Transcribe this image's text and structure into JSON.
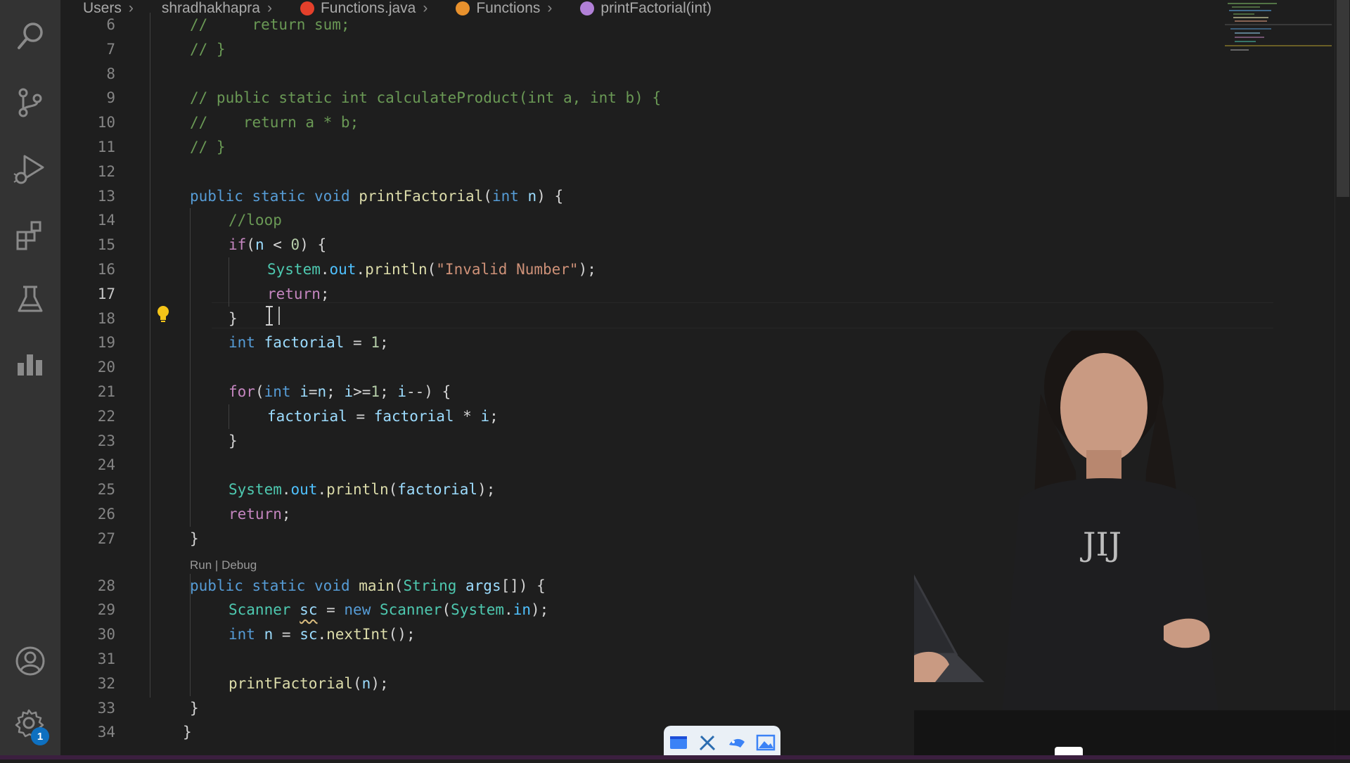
{
  "breadcrumb": [
    {
      "label": "Users",
      "icon": "",
      "icon_color": ""
    },
    {
      "label": "shradhakhapra",
      "icon": "",
      "icon_color": ""
    },
    {
      "label": "Functions.java",
      "icon": "java-file-icon",
      "icon_color": "#e5402b"
    },
    {
      "label": "Functions",
      "icon": "class-symbol-icon",
      "icon_color": "#e8912d"
    },
    {
      "label": "printFactorial(int)",
      "icon": "method-symbol-icon",
      "icon_color": "#b180d7"
    }
  ],
  "activity_bar": {
    "items": [
      {
        "name": "search-icon"
      },
      {
        "name": "source-control-icon"
      },
      {
        "name": "run-debug-icon"
      },
      {
        "name": "extensions-icon"
      },
      {
        "name": "testing-icon"
      },
      {
        "name": "charts-icon"
      }
    ],
    "bottom": [
      {
        "name": "accounts-icon"
      },
      {
        "name": "manage-gear-icon",
        "badge": "1"
      }
    ]
  },
  "editor": {
    "active_line": 17,
    "codelens": {
      "before_line": 28,
      "run": "Run",
      "separator": " | ",
      "debug": "Debug"
    },
    "lines": [
      {
        "n": 6,
        "indent": 1,
        "tokens": [
          [
            "cmt",
            "//     return sum;"
          ]
        ]
      },
      {
        "n": 7,
        "indent": 1,
        "tokens": [
          [
            "cmt",
            "// }"
          ]
        ]
      },
      {
        "n": 8,
        "indent": 0,
        "tokens": []
      },
      {
        "n": 9,
        "indent": 1,
        "tokens": [
          [
            "cmt",
            "// public static int calculateProduct(int a, int b) {"
          ]
        ]
      },
      {
        "n": 10,
        "indent": 1,
        "tokens": [
          [
            "cmt",
            "//    return a * b;"
          ]
        ]
      },
      {
        "n": 11,
        "indent": 1,
        "tokens": [
          [
            "cmt",
            "// }"
          ]
        ]
      },
      {
        "n": 12,
        "indent": 0,
        "tokens": []
      },
      {
        "n": 13,
        "indent": 1,
        "tokens": [
          [
            "kw",
            "public"
          ],
          [
            "p",
            " "
          ],
          [
            "kw",
            "static"
          ],
          [
            "p",
            " "
          ],
          [
            "kw",
            "void"
          ],
          [
            "p",
            " "
          ],
          [
            "fn",
            "printFactorial"
          ],
          [
            "p",
            "("
          ],
          [
            "kw",
            "int"
          ],
          [
            "p",
            " "
          ],
          [
            "var",
            "n"
          ],
          [
            "p",
            ") {"
          ]
        ]
      },
      {
        "n": 14,
        "indent": 2,
        "tokens": [
          [
            "cmt",
            "//loop"
          ]
        ]
      },
      {
        "n": 15,
        "indent": 2,
        "tokens": [
          [
            "ctl",
            "if"
          ],
          [
            "p",
            "("
          ],
          [
            "var",
            "n"
          ],
          [
            "p",
            " < "
          ],
          [
            "num",
            "0"
          ],
          [
            "p",
            ") {"
          ]
        ]
      },
      {
        "n": 16,
        "indent": 3,
        "tokens": [
          [
            "type",
            "System"
          ],
          [
            "p",
            "."
          ],
          [
            "var2",
            "out"
          ],
          [
            "p",
            "."
          ],
          [
            "fn",
            "println"
          ],
          [
            "p",
            "("
          ],
          [
            "str",
            "\"Invalid Number\""
          ],
          [
            "p",
            ");"
          ]
        ]
      },
      {
        "n": 17,
        "indent": 3,
        "tokens": [
          [
            "ctl",
            "return"
          ],
          [
            "p",
            ";"
          ]
        ]
      },
      {
        "n": 18,
        "indent": 2,
        "tokens": [
          [
            "p",
            "}"
          ]
        ]
      },
      {
        "n": 19,
        "indent": 2,
        "tokens": [
          [
            "kw",
            "int"
          ],
          [
            "p",
            " "
          ],
          [
            "var",
            "factorial"
          ],
          [
            "p",
            " = "
          ],
          [
            "num",
            "1"
          ],
          [
            "p",
            ";"
          ]
        ]
      },
      {
        "n": 20,
        "indent": 0,
        "tokens": []
      },
      {
        "n": 21,
        "indent": 2,
        "tokens": [
          [
            "ctl",
            "for"
          ],
          [
            "p",
            "("
          ],
          [
            "kw",
            "int"
          ],
          [
            "p",
            " "
          ],
          [
            "var",
            "i"
          ],
          [
            "p",
            "="
          ],
          [
            "var",
            "n"
          ],
          [
            "p",
            "; "
          ],
          [
            "var",
            "i"
          ],
          [
            "p",
            ">="
          ],
          [
            "num",
            "1"
          ],
          [
            "p",
            "; "
          ],
          [
            "var",
            "i"
          ],
          [
            "p",
            "--) {"
          ]
        ]
      },
      {
        "n": 22,
        "indent": 3,
        "tokens": [
          [
            "var",
            "factorial"
          ],
          [
            "p",
            " = "
          ],
          [
            "var",
            "factorial"
          ],
          [
            "p",
            " * "
          ],
          [
            "var",
            "i"
          ],
          [
            "p",
            ";"
          ]
        ]
      },
      {
        "n": 23,
        "indent": 2,
        "tokens": [
          [
            "p",
            "}"
          ]
        ]
      },
      {
        "n": 24,
        "indent": 0,
        "tokens": []
      },
      {
        "n": 25,
        "indent": 2,
        "tokens": [
          [
            "type",
            "System"
          ],
          [
            "p",
            "."
          ],
          [
            "var2",
            "out"
          ],
          [
            "p",
            "."
          ],
          [
            "fn",
            "println"
          ],
          [
            "p",
            "("
          ],
          [
            "var",
            "factorial"
          ],
          [
            "p",
            ");"
          ]
        ]
      },
      {
        "n": 26,
        "indent": 2,
        "tokens": [
          [
            "ctl",
            "return"
          ],
          [
            "p",
            ";"
          ]
        ]
      },
      {
        "n": 27,
        "indent": 1,
        "tokens": [
          [
            "p",
            "}"
          ]
        ]
      },
      {
        "n": 28,
        "indent": 1,
        "tokens": [
          [
            "kw",
            "public"
          ],
          [
            "p",
            " "
          ],
          [
            "kw",
            "static"
          ],
          [
            "p",
            " "
          ],
          [
            "kw",
            "void"
          ],
          [
            "p",
            " "
          ],
          [
            "fn",
            "main"
          ],
          [
            "p",
            "("
          ],
          [
            "type",
            "String"
          ],
          [
            "p",
            " "
          ],
          [
            "var",
            "args"
          ],
          [
            "p",
            "[]) {"
          ]
        ]
      },
      {
        "n": 29,
        "indent": 2,
        "tokens": [
          [
            "type",
            "Scanner"
          ],
          [
            "p",
            " "
          ],
          [
            "varw",
            "sc"
          ],
          [
            "p",
            " = "
          ],
          [
            "kw",
            "new"
          ],
          [
            "p",
            " "
          ],
          [
            "type",
            "Scanner"
          ],
          [
            "p",
            "("
          ],
          [
            "type",
            "System"
          ],
          [
            "p",
            "."
          ],
          [
            "var2",
            "in"
          ],
          [
            "p",
            ");"
          ]
        ]
      },
      {
        "n": 30,
        "indent": 2,
        "tokens": [
          [
            "kw",
            "int"
          ],
          [
            "p",
            " "
          ],
          [
            "var",
            "n"
          ],
          [
            "p",
            " = "
          ],
          [
            "var",
            "sc"
          ],
          [
            "p",
            "."
          ],
          [
            "fn",
            "nextInt"
          ],
          [
            "p",
            "();"
          ]
        ]
      },
      {
        "n": 31,
        "indent": 0,
        "tokens": []
      },
      {
        "n": 32,
        "indent": 2,
        "tokens": [
          [
            "fn",
            "printFactorial"
          ],
          [
            "p",
            "("
          ],
          [
            "var",
            "n"
          ],
          [
            "p",
            ");"
          ]
        ]
      },
      {
        "n": 33,
        "indent": 1,
        "tokens": [
          [
            "p",
            "}"
          ]
        ]
      },
      {
        "n": 34,
        "indent": 0,
        "tokens": [
          [
            "p",
            "}"
          ]
        ]
      }
    ]
  },
  "colors": {
    "kw": "#569cd6",
    "ctl": "#c586c0",
    "fn": "#dcdcaa",
    "type": "#4ec9b0",
    "var": "#9cdcfe",
    "var2": "#4fc1ff",
    "varw": "#9cdcfe",
    "str": "#ce9178",
    "num": "#b5cea8",
    "cmt": "#6a9955",
    "p": "#d4d4d4"
  },
  "taskbar": {
    "items": [
      "window-icon",
      "tools-icon",
      "paint-icon",
      "image-icon"
    ]
  }
}
